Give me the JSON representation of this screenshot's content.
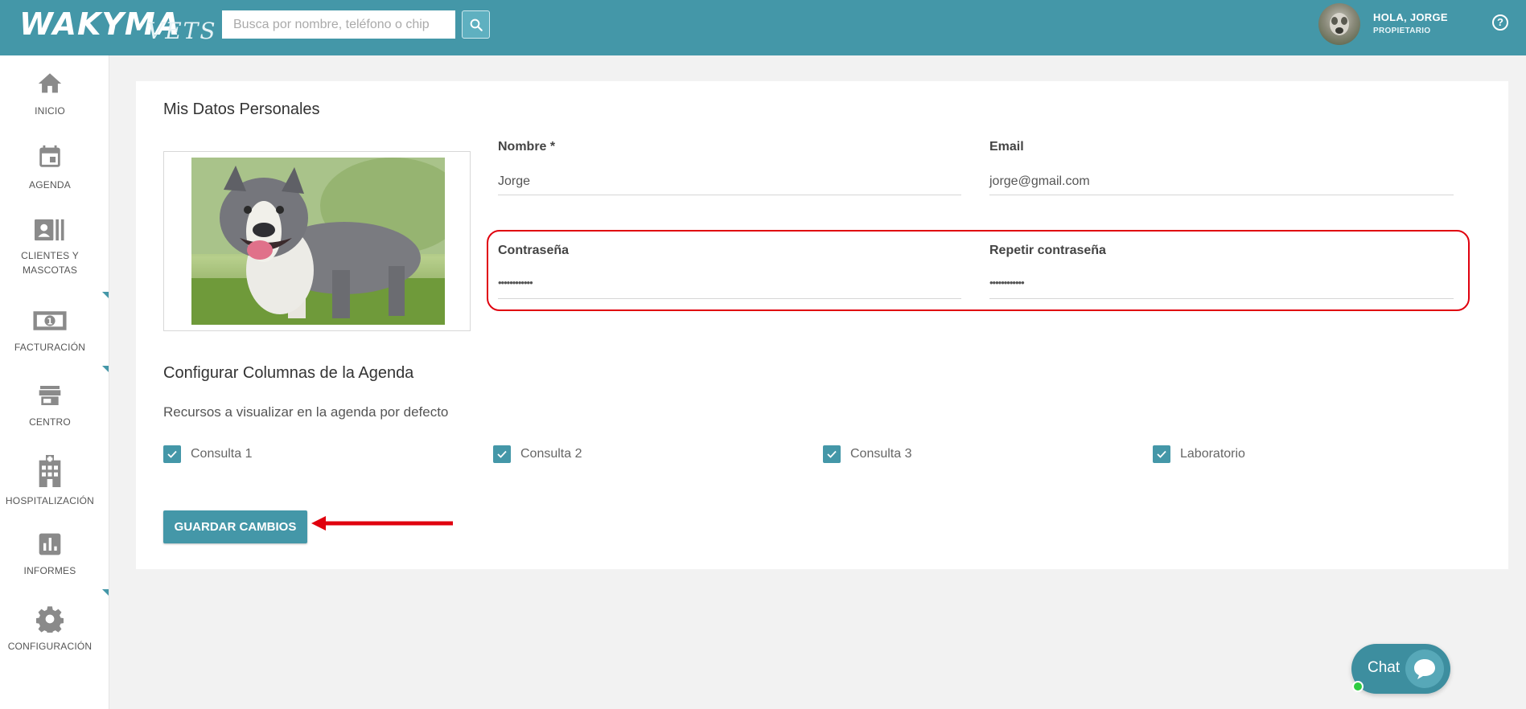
{
  "header": {
    "logo": "WAKYMA",
    "logo_sub": "VETS",
    "search_placeholder": "Busca por nombre, teléfono o chip",
    "greeting": "HOLA, JORGE",
    "role": "PROPIETARIO",
    "help": "?"
  },
  "sidebar": {
    "items": [
      {
        "label": "INICIO",
        "icon": "home-icon"
      },
      {
        "label": "AGENDA",
        "icon": "calendar-icon"
      },
      {
        "label": "CLIENTES Y MASCOTAS",
        "icon": "contacts-icon"
      },
      {
        "label": "FACTURACIÓN",
        "icon": "money-icon"
      },
      {
        "label": "CENTRO",
        "icon": "store-icon"
      },
      {
        "label": "HOSPITALIZACIÓN",
        "icon": "hospital-icon"
      },
      {
        "label": "INFORMES",
        "icon": "chart-icon"
      },
      {
        "label": "CONFIGURACIÓN",
        "icon": "gear-icon"
      }
    ]
  },
  "profile": {
    "title": "Mis Datos Personales",
    "name_label": "Nombre *",
    "name_value": "Jorge",
    "email_label": "Email",
    "email_value": "jorge@gmail.com",
    "password_label": "Contraseña",
    "password_value": "••••••••••••",
    "repeat_password_label": "Repetir contraseña",
    "repeat_password_value": "••••••••••••"
  },
  "agenda_config": {
    "title": "Configurar Columnas de la Agenda",
    "subtitle": "Recursos a visualizar en la agenda por defecto",
    "resources": [
      {
        "label": "Consulta 1",
        "checked": true
      },
      {
        "label": "Consulta 2",
        "checked": true
      },
      {
        "label": "Consulta 3",
        "checked": true
      },
      {
        "label": "Laboratorio",
        "checked": true
      }
    ]
  },
  "save_button": "GUARDAR CAMBIOS",
  "chat": {
    "label": "Chat",
    "status": "online"
  },
  "colors": {
    "primary": "#4497a8",
    "highlight": "#e0000e",
    "online": "#2ecc40"
  }
}
